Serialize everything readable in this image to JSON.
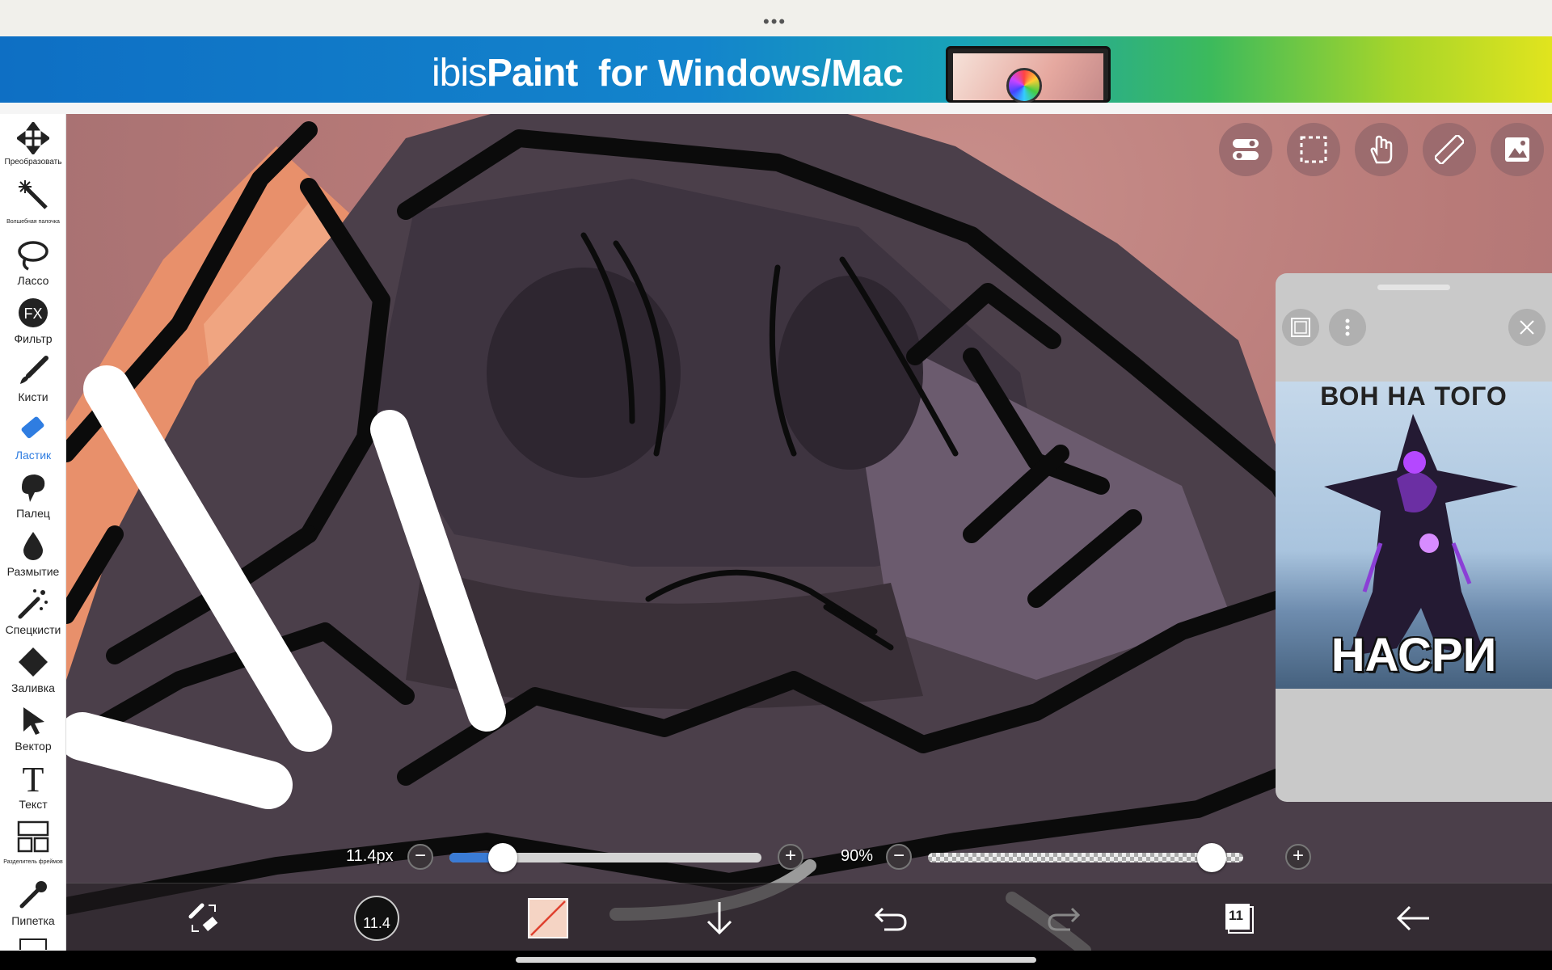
{
  "banner": {
    "logo_light": "ibis",
    "logo_bold": "Paint",
    "tagline": "for Windows/Mac"
  },
  "toolbar": {
    "items": [
      {
        "label": "Преобразовать",
        "icon": "transform-icon"
      },
      {
        "label": "Волшебная палочка",
        "icon": "magic-wand-icon"
      },
      {
        "label": "Лассо",
        "icon": "lasso-icon"
      },
      {
        "label": "Фильтр",
        "icon": "fx-filter-icon"
      },
      {
        "label": "Кисти",
        "icon": "brush-icon"
      },
      {
        "label": "Ластик",
        "icon": "eraser-icon"
      },
      {
        "label": "Палец",
        "icon": "smudge-icon"
      },
      {
        "label": "Размытие",
        "icon": "blur-drop-icon"
      },
      {
        "label": "Спецкисти",
        "icon": "special-brush-icon"
      },
      {
        "label": "Заливка",
        "icon": "fill-bucket-icon"
      },
      {
        "label": "Вектор",
        "icon": "vector-cursor-icon"
      },
      {
        "label": "Текст",
        "icon": "text-icon"
      },
      {
        "label": "Разделитель фреймов",
        "icon": "frame-divider-icon"
      },
      {
        "label": "Пипетка",
        "icon": "eyedropper-icon"
      }
    ],
    "active": "Ластик"
  },
  "reference": {
    "top_text": "ВОН НА ТОГО",
    "bottom_text": "НАСРИ"
  },
  "sliders": {
    "size_label": "11.4px",
    "size_fraction": 0.17,
    "opacity_label": "90%",
    "opacity_fraction": 0.9
  },
  "bottom": {
    "brush_size": "11.4",
    "layer_count": "11"
  },
  "colors": {
    "accent": "#2f7de1",
    "canvas_bg": "#b87a78",
    "line": "#0b0b0b"
  }
}
